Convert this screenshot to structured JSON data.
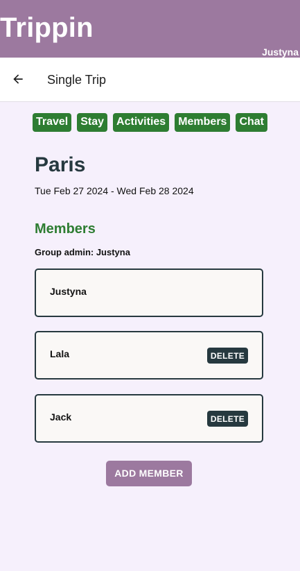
{
  "app": {
    "title": "Trippin",
    "user": "Justyna"
  },
  "toolbar": {
    "back_icon": "arrow-left-icon",
    "title": "Single Trip"
  },
  "tabs": [
    {
      "label": "Travel"
    },
    {
      "label": "Stay"
    },
    {
      "label": "Activities"
    },
    {
      "label": "Members"
    },
    {
      "label": "Chat"
    }
  ],
  "trip": {
    "city": "Paris",
    "dates": "Tue Feb 27 2024 - Wed Feb 28 2024"
  },
  "members_section": {
    "title": "Members",
    "group_admin": "Group admin: Justyna",
    "members": [
      {
        "name": "Justyna",
        "delete_label": null
      },
      {
        "name": "Lala",
        "delete_label": "DELETE"
      },
      {
        "name": "Jack",
        "delete_label": "DELETE"
      }
    ],
    "add_label": "ADD MEMBER"
  },
  "colors": {
    "header": "#9c799f",
    "tab": "#2e7d32",
    "dark": "#26393f",
    "background": "#f6f0fc"
  }
}
